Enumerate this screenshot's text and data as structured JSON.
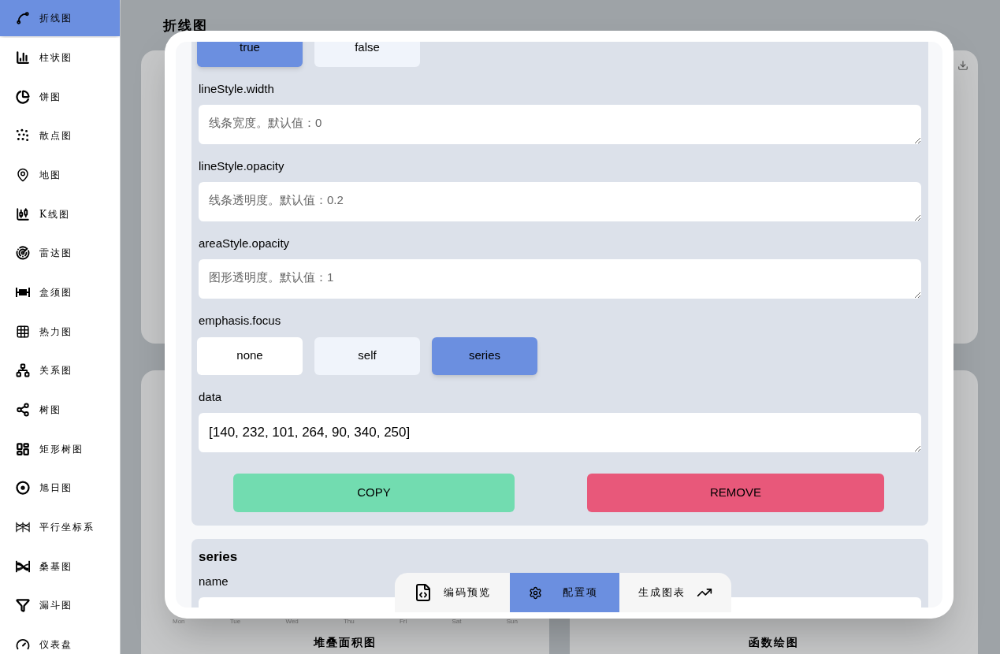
{
  "sidebar": {
    "items": [
      {
        "label": "折线图",
        "selected": true
      },
      {
        "label": "柱状图",
        "selected": false
      },
      {
        "label": "饼图",
        "selected": false
      },
      {
        "label": "散点图",
        "selected": false
      },
      {
        "label": "地图",
        "selected": false
      },
      {
        "label": "K线图",
        "selected": false
      },
      {
        "label": "雷达图",
        "selected": false
      },
      {
        "label": "盒须图",
        "selected": false
      },
      {
        "label": "热力图",
        "selected": false
      },
      {
        "label": "关系图",
        "selected": false
      },
      {
        "label": "树图",
        "selected": false
      },
      {
        "label": "矩形树图",
        "selected": false
      },
      {
        "label": "旭日图",
        "selected": false
      },
      {
        "label": "平行坐标系",
        "selected": false
      },
      {
        "label": "桑基图",
        "selected": false
      },
      {
        "label": "漏斗图",
        "selected": false
      },
      {
        "label": "仪表盘",
        "selected": false
      }
    ]
  },
  "page_title": "折线图",
  "background_cards": [
    {
      "title": "堆叠面积图",
      "x_labels": [
        "Mon",
        "Tue",
        "Wed",
        "Thu",
        "Fri",
        "Sat",
        "Sun"
      ]
    },
    {
      "title": "函数绘图"
    }
  ],
  "modal": {
    "panels": [
      {
        "sections": [
          {
            "kind": "options",
            "options": [
              {
                "label": "true",
                "selected": true
              },
              {
                "label": "false",
                "selected": false
              }
            ]
          },
          {
            "kind": "field",
            "label": "lineStyle.width",
            "placeholder": "线条宽度。默认值：0"
          },
          {
            "kind": "field",
            "label": "lineStyle.opacity",
            "placeholder": "线条透明度。默认值：0.2"
          },
          {
            "kind": "field",
            "label": "areaStyle.opacity",
            "placeholder": "图形透明度。默认值：1"
          },
          {
            "kind": "options",
            "label": "emphasis.focus",
            "options": [
              {
                "label": "none",
                "selected": false
              },
              {
                "label": "self",
                "selected": false
              },
              {
                "label": "series",
                "selected": true
              }
            ]
          },
          {
            "kind": "field",
            "label": "data",
            "value": "[140, 232, 101, 264, 90, 340, 250]"
          }
        ],
        "buttons": [
          {
            "label": "COPY",
            "kind": "copy"
          },
          {
            "label": "REMOVE",
            "kind": "remove"
          }
        ]
      },
      {
        "title": "series",
        "sections": [
          {
            "kind": "field",
            "label": "name"
          }
        ]
      }
    ],
    "toolbar": [
      {
        "label": "编码预览",
        "kind": "code",
        "selected": false
      },
      {
        "label": "配置项",
        "kind": "settings",
        "selected": true
      },
      {
        "label": "生成图表",
        "kind": "chart",
        "selected": false
      }
    ]
  }
}
